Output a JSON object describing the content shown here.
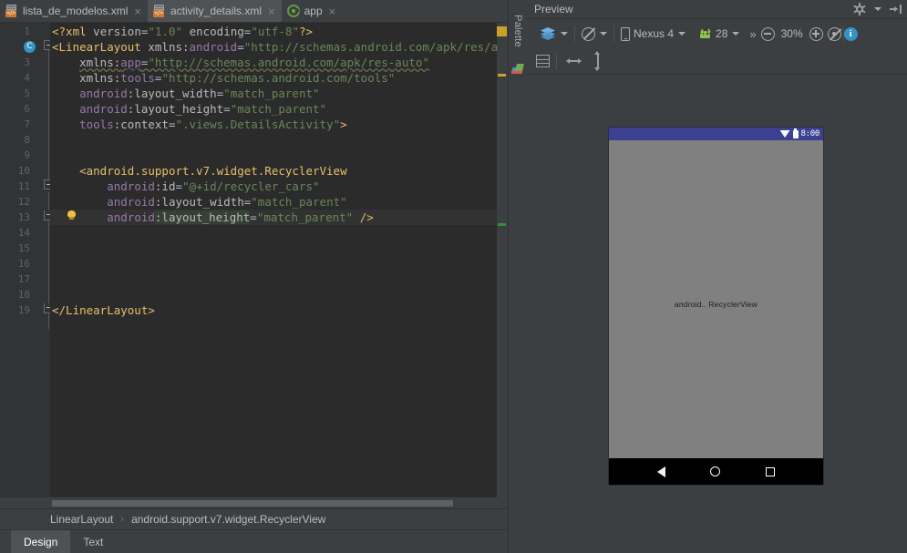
{
  "editor": {
    "tabs": [
      {
        "label": "lista_de_modelos.xml",
        "icon": "xml-file-icon",
        "active": false,
        "close": "×"
      },
      {
        "label": "activity_details.xml",
        "icon": "xml-file-icon",
        "active": true,
        "close": "×"
      },
      {
        "label": "app",
        "icon": "module-icon",
        "active": false,
        "close": "×"
      }
    ],
    "gutter_badge": "C",
    "line_numbers": [
      "1",
      "2",
      "3",
      "4",
      "5",
      "6",
      "7",
      "8",
      "9",
      "10",
      "11",
      "12",
      "13",
      "14",
      "15",
      "16",
      "17",
      "18",
      "19"
    ],
    "code_lines": [
      {
        "n": 1,
        "text": "<?xml version=\"1.0\" encoding=\"utf-8\"?>"
      },
      {
        "n": 2,
        "text": "<LinearLayout xmlns:android=\"http://schemas.android.com/apk/res/androi"
      },
      {
        "n": 3,
        "text": "    xmlns:app=\"http://schemas.android.com/apk/res-auto\""
      },
      {
        "n": 4,
        "text": "    xmlns:tools=\"http://schemas.android.com/tools\""
      },
      {
        "n": 5,
        "text": "    android:layout_width=\"match_parent\""
      },
      {
        "n": 6,
        "text": "    android:layout_height=\"match_parent\""
      },
      {
        "n": 7,
        "text": "    tools:context=\".views.DetailsActivity\">"
      },
      {
        "n": 8,
        "text": ""
      },
      {
        "n": 9,
        "text": ""
      },
      {
        "n": 10,
        "text": "    <android.support.v7.widget.RecyclerView"
      },
      {
        "n": 11,
        "text": "        android:id=\"@+id/recycler_cars\""
      },
      {
        "n": 12,
        "text": "        android:layout_width=\"match_parent\""
      },
      {
        "n": 13,
        "text": "        android:layout_height=\"match_parent\" />"
      },
      {
        "n": 14,
        "text": ""
      },
      {
        "n": 15,
        "text": ""
      },
      {
        "n": 16,
        "text": ""
      },
      {
        "n": 17,
        "text": ""
      },
      {
        "n": 18,
        "text": ""
      },
      {
        "n": 19,
        "text": "</LinearLayout>"
      }
    ],
    "breadcrumb": {
      "items": [
        "LinearLayout",
        "android.support.v7.widget.RecyclerView"
      ],
      "separator": "›"
    },
    "bottom_tabs": [
      {
        "label": "Design",
        "active": true
      },
      {
        "label": "Text",
        "active": false
      }
    ]
  },
  "palette": {
    "label": "Palette"
  },
  "preview": {
    "title": "Preview",
    "toolbar": {
      "layers_icon": "layers-icon",
      "orientation_icon": "orientation-icon",
      "device_icon": "phone-icon",
      "device_name": "Nexus 4",
      "api_icon": "android-icon",
      "api_level": "28",
      "overflow": "»",
      "zoom_out_icon": "zoom-out-icon",
      "zoom_level": "30%",
      "zoom_in_icon": "zoom-in-icon",
      "zoom_fit_icon": "zoom-to-fit-icon",
      "info_icon": "info-icon",
      "gear_icon": "gear-icon",
      "collapse_icon": "collapse-panel-icon"
    },
    "toolbar2": {
      "list_icon": "list-layout-icon",
      "width_icon": "expand-horizontal-icon",
      "height_icon": "expand-vertical-icon"
    },
    "device": {
      "status_time": "8:00",
      "wifi_icon": "wifi-icon",
      "battery_icon": "battery-icon",
      "placeholder_text": "android.. RecyclerView",
      "nav_back_icon": "nav-back-icon",
      "nav_home_icon": "nav-home-icon",
      "nav_recents_icon": "nav-recents-icon"
    }
  },
  "colors": {
    "accent_blue": "#3592c4",
    "status_bar": "#3b4190",
    "device_body": "#808080",
    "warning_marker": "#c9a227",
    "ok_marker": "#3a8c3a",
    "panel_bg": "#3c3f41",
    "editor_bg": "#2b2b2b"
  }
}
